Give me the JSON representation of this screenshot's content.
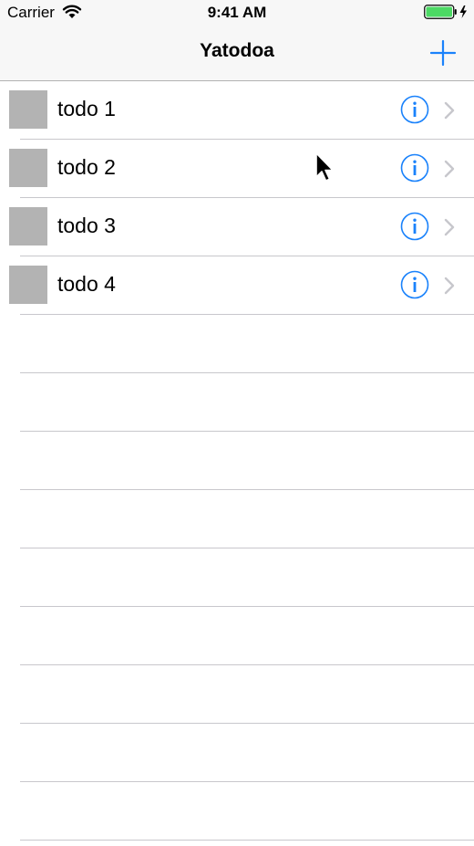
{
  "status_bar": {
    "carrier": "Carrier",
    "time": "9:41 AM",
    "battery_color": "#4cd964"
  },
  "nav": {
    "title": "Yatodoa",
    "add_icon": "plus-icon",
    "accent_color": "#1a82fb"
  },
  "rows": [
    {
      "label": "todo 1"
    },
    {
      "label": "todo 2"
    },
    {
      "label": "todo 3"
    },
    {
      "label": "todo 4"
    }
  ],
  "icons": {
    "thumbnail": "image-placeholder",
    "info": "info-circle-icon",
    "disclosure": "chevron-right-icon"
  }
}
